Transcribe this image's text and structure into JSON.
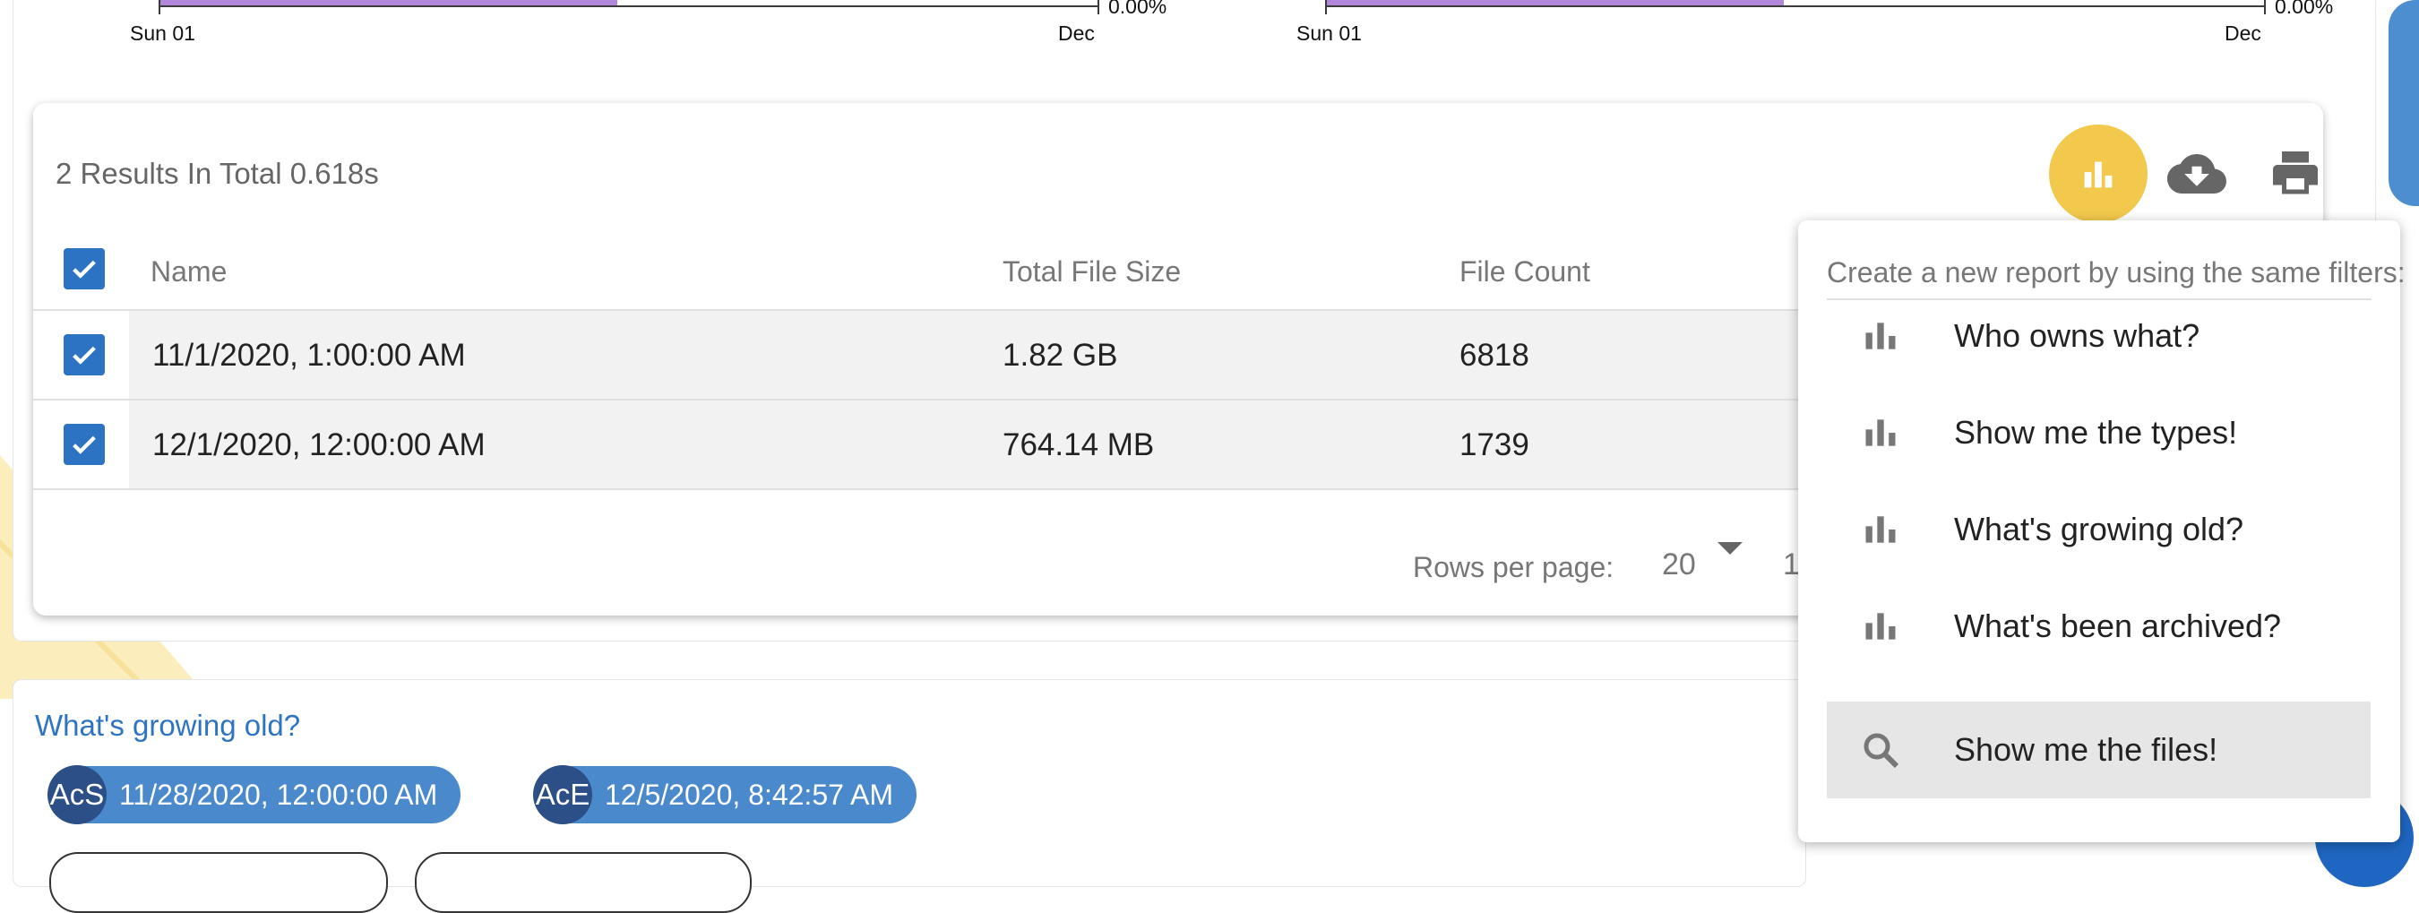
{
  "colors": {
    "accent_blue": "#2d73c4",
    "chart_bar_purple": "#b286db",
    "active_report_yellow": "#f2c94c",
    "chip_blue": "#4b89cd",
    "link_blue": "#2f74c0"
  },
  "mini_charts": [
    {
      "start_label": "Sun 01",
      "end_label": "Dec",
      "pct_label": "0.00%"
    },
    {
      "start_label": "Sun 01",
      "end_label": "Dec",
      "pct_label": "0.00%"
    }
  ],
  "results": {
    "summary": "2 Results In Total 0.618s",
    "actions": {
      "report_icon": "bar-chart-icon",
      "download_icon": "cloud-download-icon",
      "print_icon": "printer-icon"
    },
    "columns": [
      "Name",
      "Total File Size",
      "File Count"
    ],
    "rows": [
      {
        "name": "11/1/2020, 1:00:00 AM",
        "total_file_size": "1.82 GB",
        "file_count": "6818",
        "checked": true
      },
      {
        "name": "12/1/2020, 12:00:00 AM",
        "total_file_size": "764.14 MB",
        "file_count": "1739",
        "checked": true
      }
    ],
    "select_all_checked": true,
    "pagination": {
      "rows_per_page_label": "Rows per page:",
      "rows_per_page_value": "20",
      "range_partial": "1"
    }
  },
  "bottom": {
    "title": "What's growing old?",
    "chips": [
      {
        "avatar": "AcS",
        "label": "11/28/2020, 12:00:00 AM"
      },
      {
        "avatar": "AcE",
        "label": "12/5/2020, 8:42:57 AM"
      }
    ]
  },
  "report_menu": {
    "header": "Create a new report by using the same filters:",
    "items": [
      {
        "label": "Who owns what?",
        "icon": "bar-chart-icon"
      },
      {
        "label": "Show me the types!",
        "icon": "bar-chart-icon"
      },
      {
        "label": "What's growing old?",
        "icon": "bar-chart-icon"
      },
      {
        "label": "What's been archived?",
        "icon": "bar-chart-icon"
      },
      {
        "label": "Show me the files!",
        "icon": "search-icon",
        "active": true
      }
    ]
  }
}
